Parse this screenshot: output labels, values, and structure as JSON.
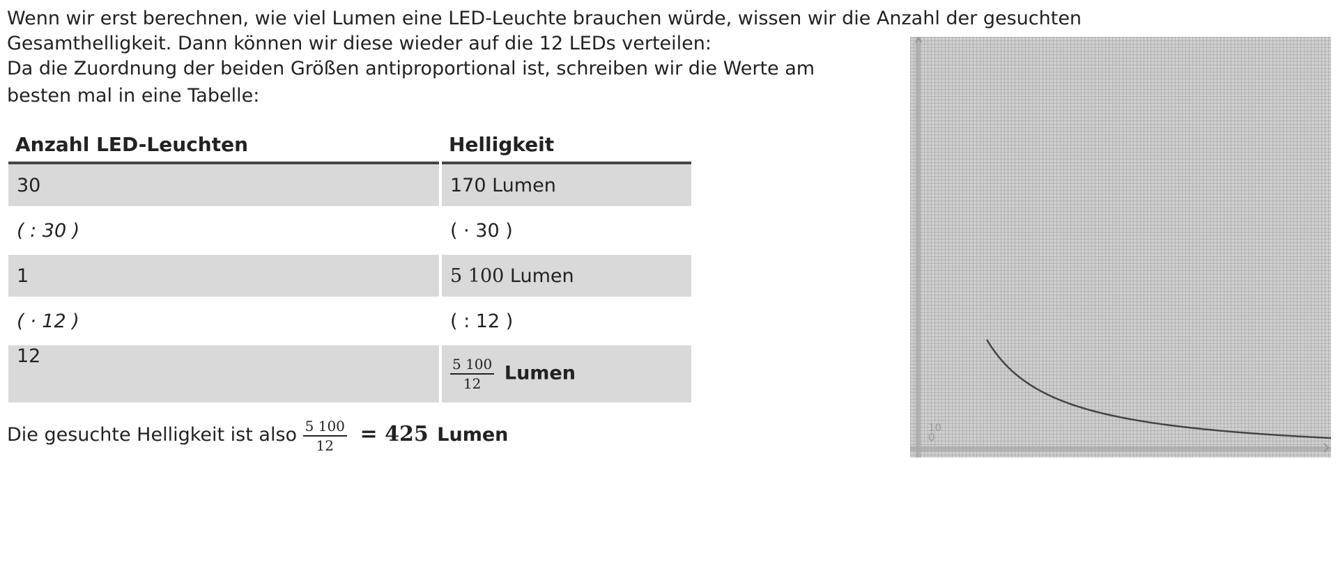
{
  "intro": {
    "line1": "Wenn wir erst berechnen, wie viel Lumen eine LED-Leuchte brauchen würde, wissen wir die Anzahl der gesuchten",
    "line2": "Gesamthelligkeit. Dann können wir diese wieder auf die 12 LEDs verteilen:",
    "line3": "Da die Zuordnung der beiden Größen antiproportional ist, schreiben wir die Werte am",
    "line4": "besten mal in eine Tabelle:"
  },
  "table": {
    "headers": [
      "Anzahl LED-Leuchten",
      "Helligkeit"
    ],
    "rows": [
      {
        "a": "30",
        "b": "170 Lumen"
      },
      {
        "a": "( : 30 )",
        "b": "( · 30 )"
      },
      {
        "a": "1",
        "b_num": "5 100",
        "b_unit": "Lumen"
      },
      {
        "a": "( · 12 )",
        "b": "( : 12 )"
      },
      {
        "a": "12",
        "b_frac_num": "5 100",
        "b_frac_den": "12",
        "b_unit": "Lumen"
      }
    ]
  },
  "conclusion": {
    "prefix": "Die gesuchte Helligkeit ist also",
    "frac_num": "5 100",
    "frac_den": "12",
    "eq": "= 425",
    "unit": "Lumen"
  },
  "graph": {
    "axis_tick_label": "10",
    "axis_origin_label": "0",
    "curve_type": "hyperbola",
    "colors": {
      "background": "#cfcfcf",
      "grid": "#a0a0a0",
      "curve": "#444444",
      "axis": "#9a9a9a"
    }
  }
}
